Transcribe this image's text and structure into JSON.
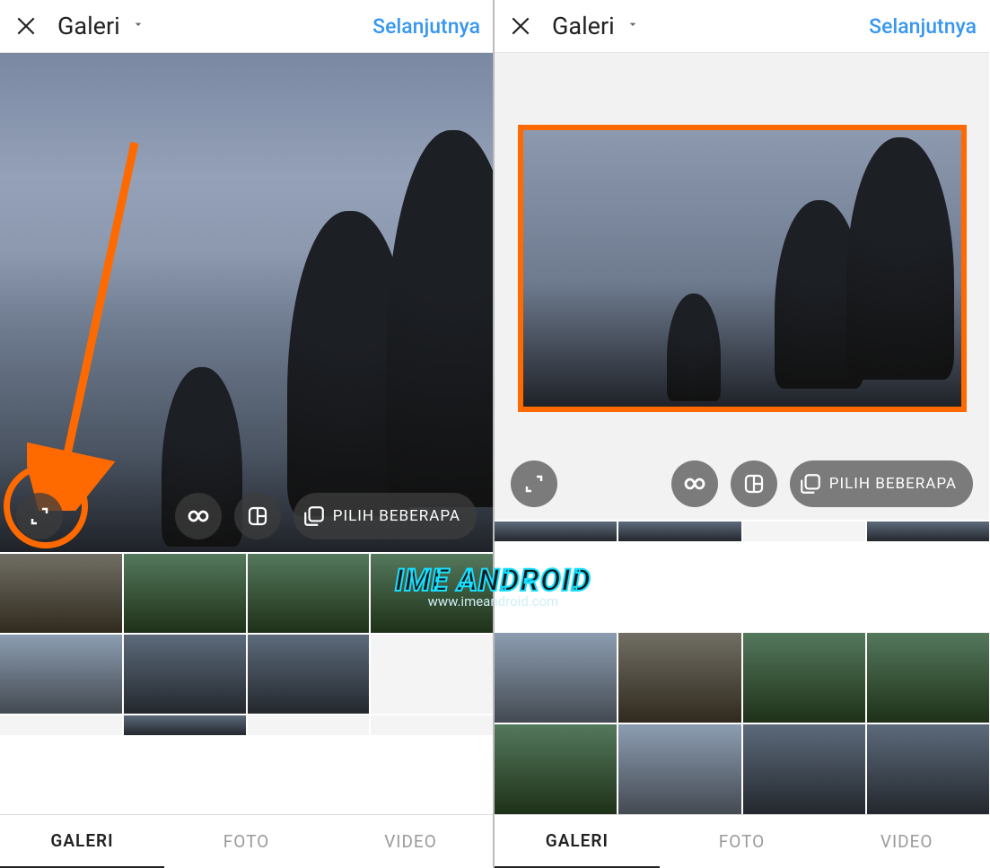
{
  "left": {
    "header": {
      "title": "Galeri",
      "next": "Selanjutnya"
    },
    "overlay": {
      "multi_select": "PILIH BEBERAPA"
    },
    "tabs": {
      "gallery": "GALERI",
      "photo": "FOTO",
      "video": "VIDEO"
    }
  },
  "right": {
    "header": {
      "title": "Galeri",
      "next": "Selanjutnya"
    },
    "overlay": {
      "multi_select": "PILIH BEBERAPA"
    },
    "tabs": {
      "gallery": "GALERI",
      "photo": "FOTO",
      "video": "VIDEO"
    }
  },
  "watermark": {
    "main": "IME ANDROID",
    "sub": "www.imeandroid.com"
  },
  "colors": {
    "accent_link": "#3897f0",
    "annotation": "#ff6a00"
  }
}
